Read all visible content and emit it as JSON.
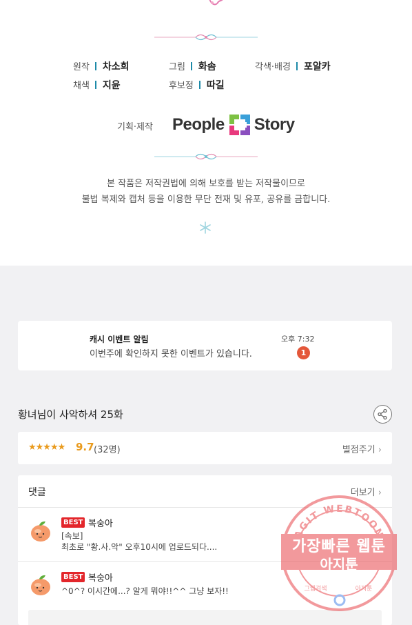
{
  "credits": {
    "items": [
      {
        "role": "원작",
        "name": "차소희"
      },
      {
        "role": "그림",
        "name": "화솜"
      },
      {
        "role": "각색·배경",
        "name": "포알카"
      },
      {
        "role": "채색",
        "name": "지윤"
      },
      {
        "role": "후보정",
        "name": "따길"
      }
    ],
    "produce_label": "기획·제작",
    "logo_left": "People",
    "logo_right": "Story",
    "copyright_line1": "본 작품은 저작권법에 의해 보호를 받는 저작물이므로",
    "copyright_line2": "불법 복제와 캡처 등을 이용한 무단 전재 및 유포, 공유를 금합니다."
  },
  "notice": {
    "title": "캐시 이벤트 알림",
    "body": "이번주에 확인하지 못한 이벤트가 있습니다.",
    "time": "오후 7:32",
    "badge": "1"
  },
  "episode": {
    "title": "황녀님이 사악하셔 25화"
  },
  "rating": {
    "stars": "★★★★★",
    "score": "9.7",
    "count": "(32명)",
    "rate_label": "별점주기",
    "rate_value": 5
  },
  "comments": {
    "title": "댓글",
    "more_label": "더보기",
    "items": [
      {
        "badge": "BEST",
        "user": "복숭아",
        "line1": "[속보]",
        "line2": "최초로 \"황.사.악\" 오후10시에 업로드되다...."
      },
      {
        "badge": "BEST",
        "user": "복숭아",
        "line1": "^0^? 이시간에...? 알게 뭐야!!^^ 그냥 보자!!"
      }
    ]
  },
  "watermark": {
    "ring_text": "AGIT WEBTOON",
    "line1": "가장빠른 웹툰",
    "line2": "아지툰",
    "bottom_left": "그웹검색",
    "bottom_right": "아지툰"
  },
  "colors": {
    "accent_bar": "#1d8aa8",
    "star": "#e99a1c",
    "badge_red": "#e3262b",
    "notice_badge": "#e4573a",
    "watermark": "#e8474d"
  },
  "icons": {
    "share": "share-icon",
    "chevron": "chevron-right-icon",
    "avatar": "peach-avatar-icon"
  }
}
